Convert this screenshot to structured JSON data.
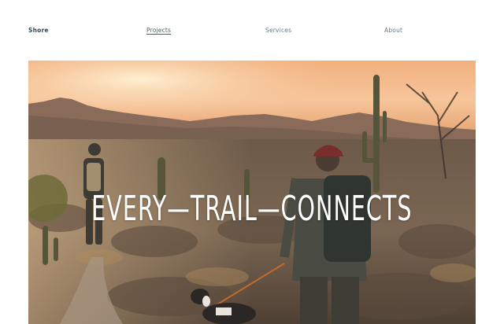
{
  "nav": {
    "brand": "Shore",
    "links": [
      {
        "label": "Projects",
        "active": true
      },
      {
        "label": "Services",
        "active": false
      },
      {
        "label": "About",
        "active": false
      }
    ]
  },
  "hero": {
    "headline": "EVERY—TRAIL—CONNECTS",
    "left_icon": "double-arrow-right-icon",
    "right_icon": "double-arrow-left-icon"
  },
  "colors": {
    "brand": "#2f4a57",
    "nav_link": "#6b7880",
    "headline": "#ffffff"
  }
}
